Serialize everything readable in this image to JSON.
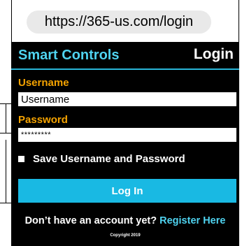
{
  "browser": {
    "url": "https://365-us.com/login"
  },
  "app": {
    "title": "Smart Controls",
    "page_title": "Login"
  },
  "form": {
    "username_label": "Username",
    "username_value": "Username",
    "password_label": "Password",
    "password_value": "*********",
    "save_label": "Save Username and Password",
    "save_checked": false,
    "login_button": "Log In"
  },
  "footer": {
    "register_prompt": "Don’t have an account yet?",
    "register_link": "Register Here",
    "copyright": "Copyright 2019"
  },
  "colors": {
    "background": "#000000",
    "brand_cyan": "#4fd3f0",
    "label_orange": "#f5a300",
    "button_blue": "#19b9e3"
  }
}
